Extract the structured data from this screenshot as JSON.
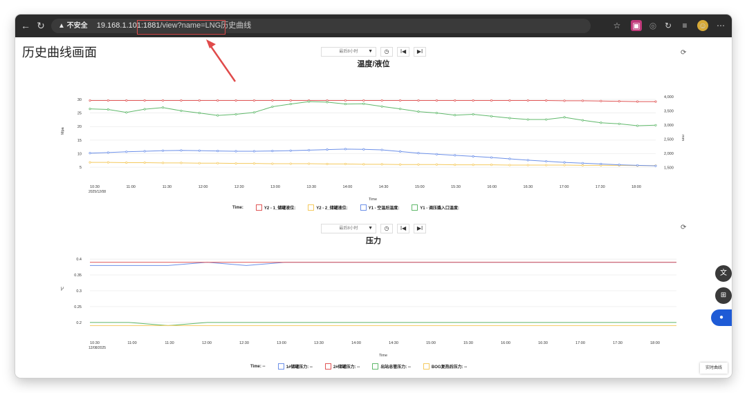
{
  "browser": {
    "security_warning": "▲ 不安全",
    "url_host": "19.168.1.101:1881",
    "url_path": "/view?name=LNG历史曲线"
  },
  "page": {
    "title": "历史曲线画面",
    "realtime_button": "实时曲线"
  },
  "controls": {
    "range_label": "最后8小时",
    "caret": "▼",
    "clock_icon": "clock-icon",
    "prev": "I◀",
    "next": "▶I"
  },
  "colors": {
    "red": "#e05555",
    "yellow": "#f4c95d",
    "blue": "#6b8fe8",
    "green": "#5fb86a"
  },
  "chart1": {
    "title": "温度/液位",
    "xlabel": "Time",
    "ylabel_left": "Mpa",
    "ylabel_right": "mm",
    "x_ticks": [
      "10:30",
      "11:00",
      "11:30",
      "12:00",
      "12:30",
      "13:00",
      "13:30",
      "14:00",
      "14:30",
      "15:00",
      "15:30",
      "16:00",
      "16:30",
      "17:00",
      "17:30",
      "18:00"
    ],
    "x_date": "2025/12/08",
    "y_left_ticks": [
      "30",
      "25",
      "20",
      "15",
      "10",
      "5"
    ],
    "y_right_ticks": [
      "4,000",
      "3,500",
      "3,000",
      "2,500",
      "2,000",
      "1,500"
    ],
    "legend_time": "Time:",
    "legend": [
      "Y2 - 1_储罐液位:",
      "Y2 - 2_储罐液位:",
      "Y1 - 空温后温度:",
      "Y1 - 调压撬入口温度:"
    ]
  },
  "chart2": {
    "title": "压力",
    "xlabel": "Time",
    "ylabel": "℃",
    "x_ticks": [
      "10:30",
      "11:00",
      "11:30",
      "12:00",
      "12:30",
      "13:00",
      "13:30",
      "14:00",
      "14:30",
      "15:00",
      "15:30",
      "16:00",
      "16:30",
      "17:00",
      "17:30",
      "18:00"
    ],
    "x_date": "12/08/2025",
    "y_ticks": [
      "0.4",
      "0.35",
      "0.3",
      "0.25",
      "0.2"
    ],
    "legend_time": "Time: --",
    "legend": [
      "1#储罐压力: --",
      "2#储罐压力: --",
      "出站总管压力: --",
      "BOG复热后压力: --"
    ]
  },
  "chart_data": [
    {
      "type": "line",
      "title": "温度/液位",
      "xlabel": "Time",
      "ylabel": "Mpa",
      "x": [
        "10:30",
        "10:45",
        "11:00",
        "11:15",
        "11:30",
        "11:45",
        "12:00",
        "12:15",
        "12:30",
        "12:45",
        "13:00",
        "13:15",
        "13:30",
        "13:45",
        "14:00",
        "14:15",
        "14:30",
        "14:45",
        "15:00",
        "15:15",
        "15:30",
        "15:45",
        "16:00",
        "16:15",
        "16:30",
        "16:45",
        "17:00",
        "17:15",
        "17:30",
        "17:45",
        "18:00",
        "18:15"
      ],
      "ylim": [
        3,
        31
      ],
      "series": [
        {
          "name": "Y2 - 1_储罐液位:",
          "color": "#e05555",
          "values": [
            29.6,
            29.6,
            29.6,
            29.6,
            29.6,
            29.6,
            29.6,
            29.6,
            29.6,
            29.6,
            29.6,
            29.6,
            29.6,
            29.6,
            29.6,
            29.6,
            29.6,
            29.6,
            29.6,
            29.6,
            29.6,
            29.6,
            29.6,
            29.6,
            29.6,
            29.6,
            29.5,
            29.5,
            29.4,
            29.3,
            29.2,
            29.2
          ]
        },
        {
          "name": "Y2 - 2_储罐液位:",
          "color": "#f4c95d",
          "values": [
            6.8,
            6.8,
            6.7,
            6.7,
            6.6,
            6.6,
            6.5,
            6.5,
            6.4,
            6.4,
            6.3,
            6.3,
            6.3,
            6.2,
            6.2,
            6.1,
            6.1,
            6.0,
            6.0,
            6.0,
            5.9,
            5.9,
            5.9,
            5.8,
            5.8,
            5.8,
            5.8,
            5.7,
            5.7,
            5.7,
            5.6,
            5.6
          ]
        },
        {
          "name": "Y1 - 空温后温度:",
          "color": "#6b8fe8",
          "values": [
            10.2,
            10.4,
            10.7,
            10.9,
            11.1,
            11.2,
            11.1,
            11.0,
            10.9,
            10.9,
            11.0,
            11.1,
            11.3,
            11.5,
            11.7,
            11.6,
            11.4,
            10.8,
            10.2,
            9.8,
            9.4,
            9.0,
            8.6,
            8.1,
            7.6,
            7.2,
            6.8,
            6.5,
            6.2,
            5.9,
            5.7,
            5.5
          ]
        },
        {
          "name": "Y1 - 调压撬入口温度:",
          "color": "#5fb86a",
          "values": [
            26.5,
            26.3,
            25.2,
            26.4,
            27.0,
            25.8,
            25.0,
            24.1,
            24.5,
            25.2,
            27.3,
            28.3,
            29.2,
            29.0,
            28.3,
            28.4,
            27.4,
            26.5,
            25.5,
            25.0,
            24.2,
            24.5,
            23.8,
            23.1,
            22.6,
            22.6,
            23.4,
            22.3,
            21.4,
            21.0,
            20.3,
            20.5
          ]
        }
      ]
    },
    {
      "type": "line",
      "title": "压力",
      "xlabel": "Time",
      "ylabel": "℃",
      "x": [
        "10:30",
        "11:00",
        "11:30",
        "12:00",
        "12:30",
        "13:00",
        "13:30",
        "14:00",
        "14:30",
        "15:00",
        "15:30",
        "16:00",
        "16:30",
        "17:00",
        "17:30",
        "18:00"
      ],
      "ylim": [
        0.18,
        0.42
      ],
      "series": [
        {
          "name": "1#储罐压力: --",
          "color": "#6b8fe8",
          "values": [
            0.38,
            0.38,
            0.38,
            0.39,
            0.38,
            0.39,
            0.39,
            0.39,
            0.39,
            0.39,
            0.39,
            0.39,
            0.39,
            0.39,
            0.39,
            0.39
          ]
        },
        {
          "name": "2#储罐压力: --",
          "color": "#e05555",
          "values": [
            0.39,
            0.39,
            0.39,
            0.39,
            0.39,
            0.39,
            0.39,
            0.39,
            0.39,
            0.39,
            0.39,
            0.39,
            0.39,
            0.39,
            0.39,
            0.39
          ]
        },
        {
          "name": "出站总管压力: --",
          "color": "#5fb86a",
          "values": [
            0.2,
            0.2,
            0.19,
            0.2,
            0.2,
            0.2,
            0.2,
            0.2,
            0.2,
            0.2,
            0.2,
            0.2,
            0.2,
            0.2,
            0.2,
            0.2
          ]
        },
        {
          "name": "BOG复热后压力: --",
          "color": "#f4c95d",
          "values": [
            0.19,
            0.19,
            0.19,
            0.19,
            0.19,
            0.19,
            0.19,
            0.19,
            0.19,
            0.19,
            0.19,
            0.19,
            0.19,
            0.19,
            0.19,
            0.19
          ]
        }
      ]
    }
  ]
}
